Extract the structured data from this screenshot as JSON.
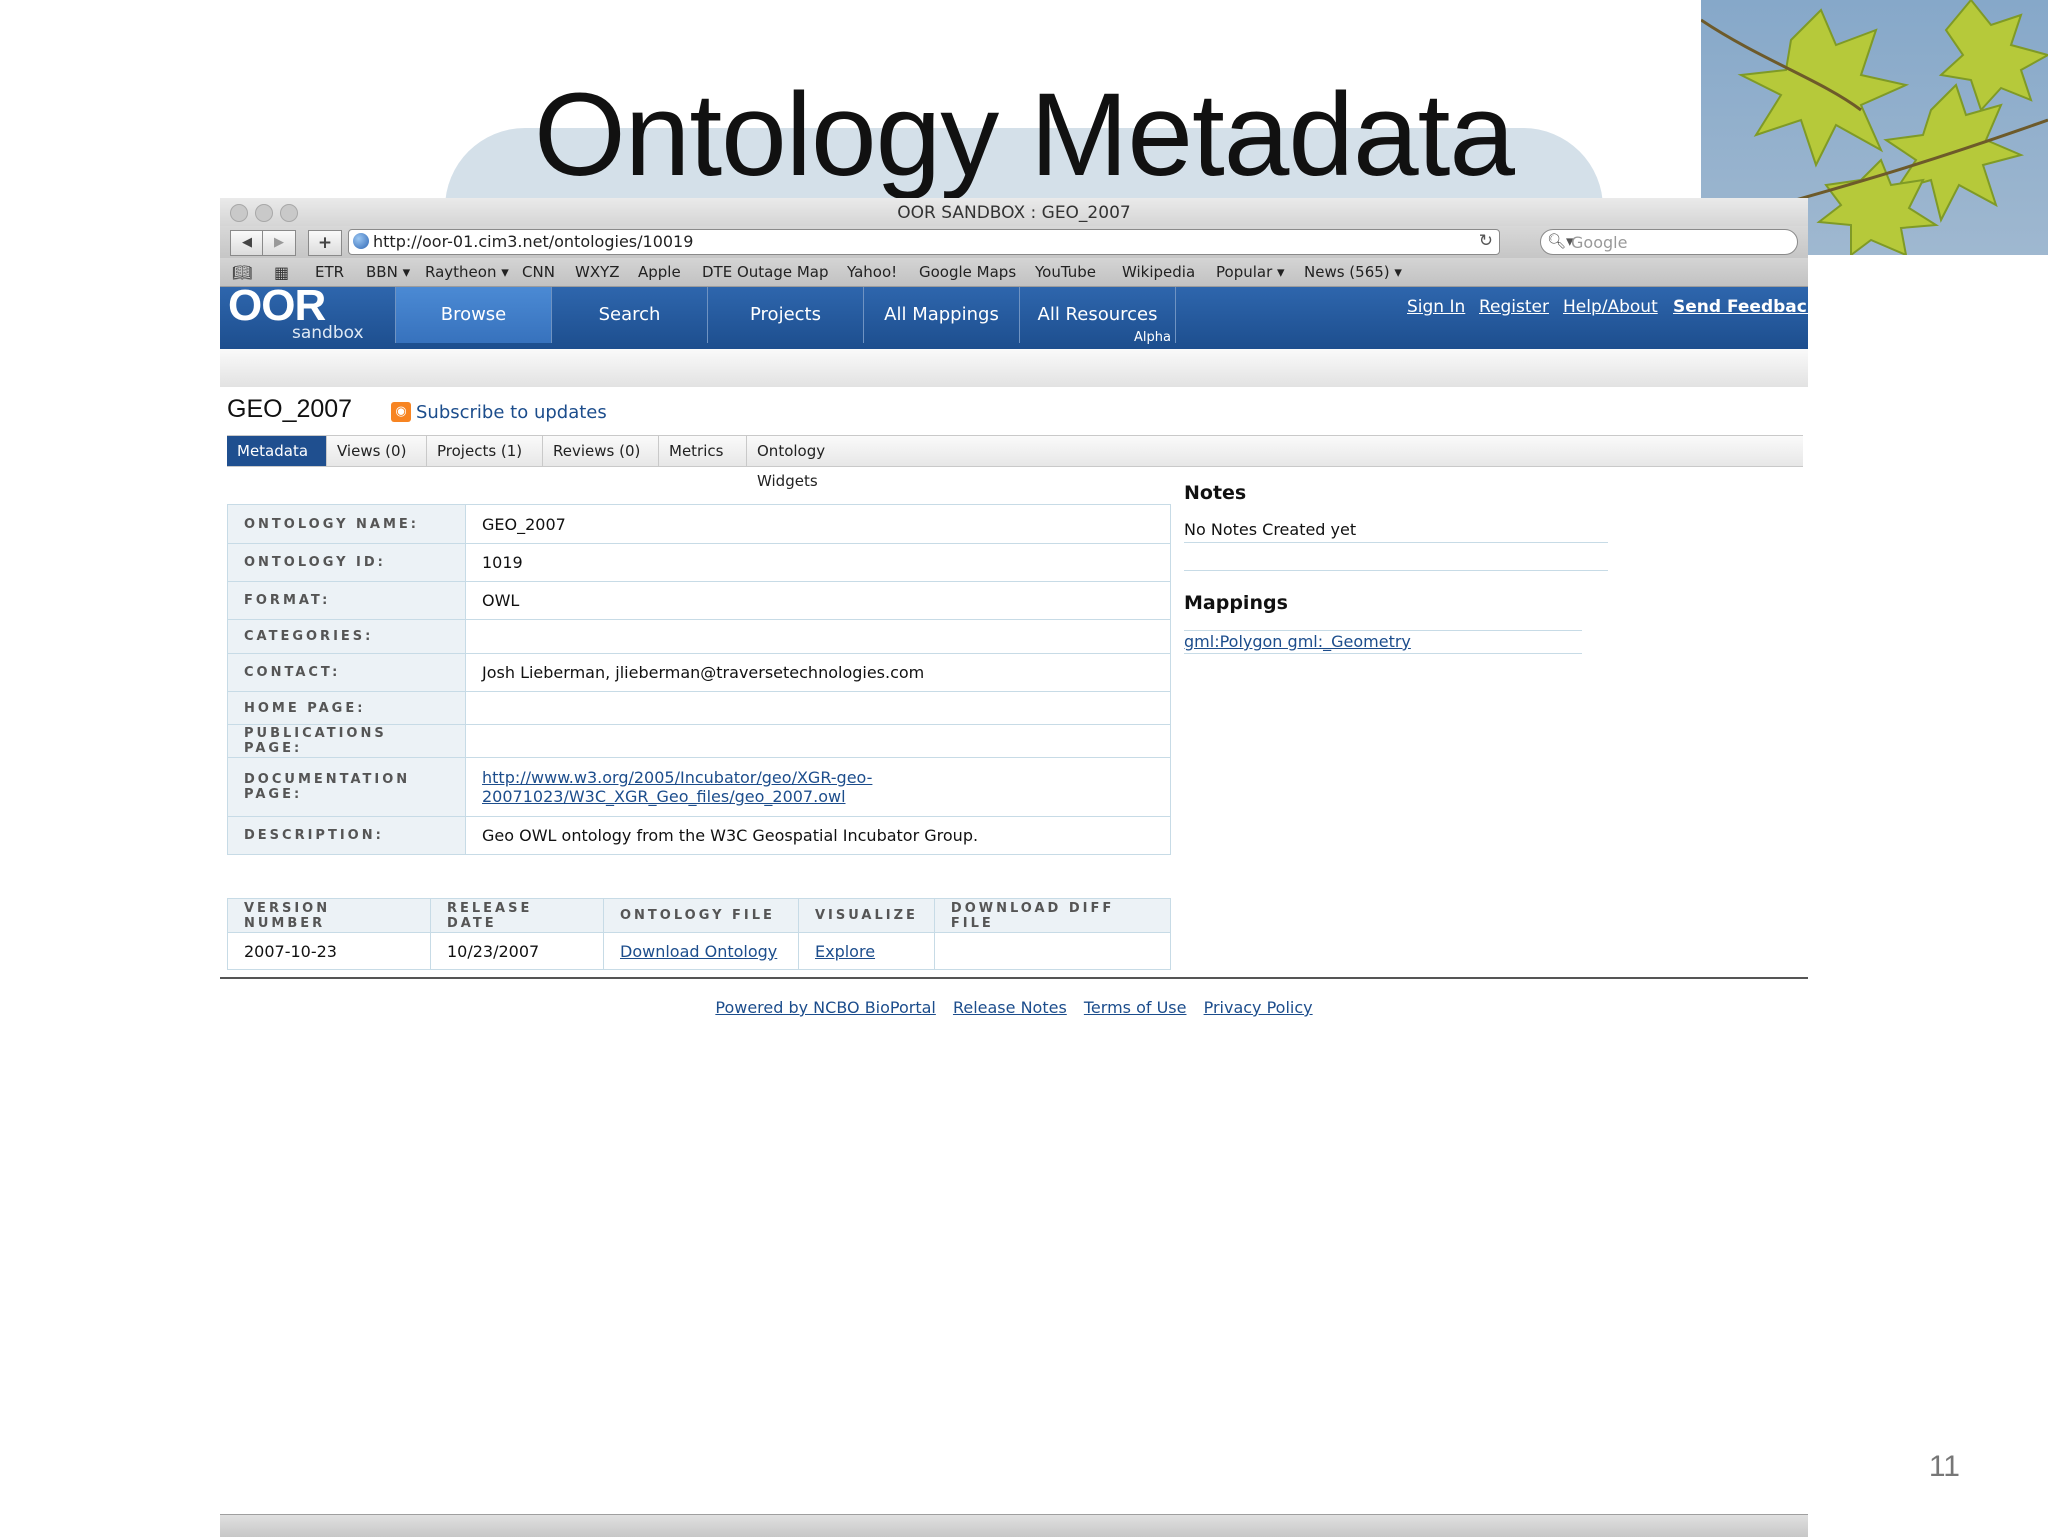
{
  "slide": {
    "title": "Ontology Metadata",
    "page_number": "11"
  },
  "browser": {
    "window_title": "OOR SANDBOX : GEO_2007",
    "url": "http://oor-01.cim3.net/ontologies/10019",
    "search_placeholder": "Google",
    "bookmarks": [
      "ETR",
      "BBN ▾",
      "Raytheon ▾",
      "CNN",
      "WXYZ",
      "Apple",
      "DTE Outage Map",
      "Yahoo!",
      "Google Maps",
      "YouTube",
      "Wikipedia",
      "Popular ▾",
      "News (565) ▾"
    ]
  },
  "site": {
    "logo": "OOR",
    "logo_sub": "sandbox",
    "nav": [
      "Browse",
      "Search",
      "Projects",
      "All Mappings",
      "All Resources"
    ],
    "nav_badge": "Alpha",
    "top_links": [
      "Sign In",
      "Register",
      "Help/About",
      "Send Feedback"
    ]
  },
  "ontology": {
    "title": "GEO_2007",
    "subscribe": "Subscribe to updates",
    "tabs": [
      "Metadata",
      "Views (0)",
      "Projects (1)",
      "Reviews (0)",
      "Metrics",
      "Ontology Widgets"
    ],
    "metadata": [
      {
        "key": "ONTOLOGY NAME:",
        "value": "GEO_2007"
      },
      {
        "key": "ONTOLOGY ID:",
        "value": "1019"
      },
      {
        "key": "FORMAT:",
        "value": "OWL"
      },
      {
        "key": "CATEGORIES:",
        "value": ""
      },
      {
        "key": "CONTACT:",
        "value": "Josh Lieberman, jlieberman@traversetechnologies.com"
      },
      {
        "key": "HOME PAGE:",
        "value": ""
      },
      {
        "key": "PUBLICATIONS PAGE:",
        "value": ""
      },
      {
        "key": "DOCUMENTATION PAGE:",
        "value_line1": "http://www.w3.org/2005/Incubator/geo/XGR-geo-",
        "value_line2": "20071023/W3C_XGR_Geo_files/geo_2007.owl"
      },
      {
        "key": "DESCRIPTION:",
        "value": "Geo OWL ontology from the W3C Geospatial Incubator Group."
      }
    ],
    "versions": {
      "headers": [
        "VERSION NUMBER",
        "RELEASE DATE",
        "ONTOLOGY FILE",
        "VISUALIZE",
        "DOWNLOAD DIFF FILE"
      ],
      "row": [
        "2007-10-23",
        "10/23/2007",
        "Download Ontology",
        "Explore",
        ""
      ]
    }
  },
  "sidebar": {
    "notes_title": "Notes",
    "notes_text": "No Notes Created yet",
    "mappings_title": "Mappings",
    "mapping_link": "gml:Polygon gml:_Geometry"
  },
  "footer": {
    "links": [
      "Powered by NCBO BioPortal",
      "Release Notes",
      "Terms of Use",
      "Privacy Policy"
    ]
  },
  "colors": {
    "header_blue": "#1d4e8e",
    "active_tab_blue": "#3772bd",
    "link_blue": "#1c4d8c",
    "table_border": "#c7dbe6",
    "rss_orange": "#f78422"
  }
}
